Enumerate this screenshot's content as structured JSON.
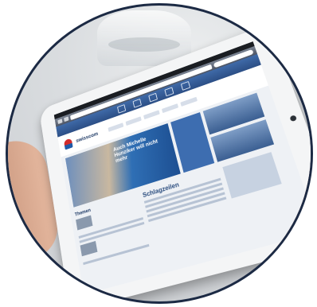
{
  "photo": {
    "subject": "tablet-browsing-website",
    "frame": "circular"
  },
  "tablet_screen": {
    "site_logo_text": "swisscom",
    "hero_headline": "Auch Michelle Hunziker will nicht mehr",
    "news_section_label": "Themen",
    "headlines_section_label": "Schlagzeilen"
  },
  "colors": {
    "frame_border": "#1c2a44",
    "site_toolbar": "#2c4f86",
    "brand_red": "#d22b2b"
  }
}
